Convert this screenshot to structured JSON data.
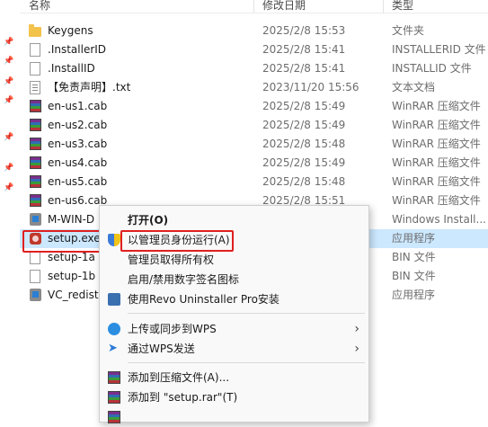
{
  "header": {
    "col_name": "名称",
    "col_date": "修改日期",
    "col_type": "类型"
  },
  "files": [
    {
      "name": "Keygens",
      "date": "2025/2/8 15:53",
      "type": "文件夹",
      "icon": "folder-icon"
    },
    {
      "name": ".InstallerID",
      "date": "2025/2/8 15:41",
      "type": "INSTALLERID 文件",
      "icon": "file-icon"
    },
    {
      "name": ".InstallID",
      "date": "2025/2/8 15:41",
      "type": "INSTALLID 文件",
      "icon": "file-icon"
    },
    {
      "name": "【免责声明】.txt",
      "date": "2023/11/20 15:56",
      "type": "文本文档",
      "icon": "text-file-icon"
    },
    {
      "name": "en-us1.cab",
      "date": "2025/2/8 15:49",
      "type": "WinRAR 压缩文件",
      "icon": "winrar-icon"
    },
    {
      "name": "en-us2.cab",
      "date": "2025/2/8 15:49",
      "type": "WinRAR 压缩文件",
      "icon": "winrar-icon"
    },
    {
      "name": "en-us3.cab",
      "date": "2025/2/8 15:48",
      "type": "WinRAR 压缩文件",
      "icon": "winrar-icon"
    },
    {
      "name": "en-us4.cab",
      "date": "2025/2/8 15:49",
      "type": "WinRAR 压缩文件",
      "icon": "winrar-icon"
    },
    {
      "name": "en-us5.cab",
      "date": "2025/2/8 15:48",
      "type": "WinRAR 压缩文件",
      "icon": "winrar-icon"
    },
    {
      "name": "en-us6.cab",
      "date": "2025/2/8 15:51",
      "type": "WinRAR 压缩文件",
      "icon": "winrar-icon"
    },
    {
      "name": "M-WIN-D",
      "date": "",
      "type": "Windows Install...",
      "icon": "installer-icon"
    },
    {
      "name": "setup.exe",
      "date": "",
      "type": "应用程序",
      "icon": "setup-exe-icon"
    },
    {
      "name": "setup-1a",
      "date": "",
      "type": "BIN 文件",
      "icon": "file-icon"
    },
    {
      "name": "setup-1b",
      "date": "",
      "type": "BIN 文件",
      "icon": "file-icon"
    },
    {
      "name": "VC_redist",
      "date": "",
      "type": "应用程序",
      "icon": "installer-icon"
    }
  ],
  "context_menu": {
    "open": "打开(O)",
    "run_as_admin": "以管理员身份运行(A)",
    "take_ownership": "管理员取得所有权",
    "signature_icon": "启用/禁用数字签名图标",
    "revo": "使用Revo Uninstaller Pro安装",
    "upload_wps": "上传或同步到WPS",
    "send_wps": "通过WPS发送",
    "add_archive": "添加到压缩文件(A)...",
    "add_setup_rar": "添加到 \"setup.rar\"(T)"
  },
  "colors": {
    "selection": "#cce8ff",
    "highlight_box": "#e02020",
    "menu_hover": "#e6f0fb"
  }
}
